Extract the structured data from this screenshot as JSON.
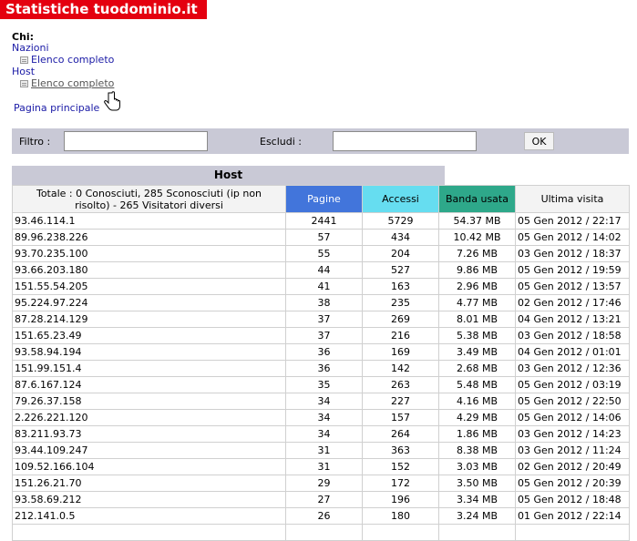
{
  "title": "Statistiche tuodominio.it",
  "nav": {
    "who_label": "Chi:",
    "nazioni": "Nazioni",
    "nazioni_full": "Elenco completo",
    "host": "Host",
    "host_full": "Elenco completo",
    "home": "Pagina principale"
  },
  "filter": {
    "filtro_label": "Filtro :",
    "escludi_label": "Escludi :",
    "filtro_value": "",
    "escludi_value": "",
    "ok_label": "OK"
  },
  "section_title": "Host",
  "columns": {
    "totale": "Totale : 0 Conosciuti, 285 Sconosciuti (ip non risolto) - 265 Visitatori diversi",
    "pagine": "Pagine",
    "accessi": "Accessi",
    "banda": "Banda usata",
    "ultima": "Ultima visita"
  },
  "colors": {
    "title_bg": "#e4000f",
    "pagine": "#4275db",
    "accessi": "#66ddf0",
    "banda": "#2ea88a",
    "bar": "#c9c9d6"
  },
  "rows": [
    {
      "host": "93.46.114.1",
      "pagine": "2441",
      "accessi": "5729",
      "banda": "54.37 MB",
      "ultima": "05 Gen 2012 / 22:17"
    },
    {
      "host": "89.96.238.226",
      "pagine": "57",
      "accessi": "434",
      "banda": "10.42 MB",
      "ultima": "05 Gen 2012 / 14:02"
    },
    {
      "host": "93.70.235.100",
      "pagine": "55",
      "accessi": "204",
      "banda": "7.26 MB",
      "ultima": "03 Gen 2012 / 18:37"
    },
    {
      "host": "93.66.203.180",
      "pagine": "44",
      "accessi": "527",
      "banda": "9.86 MB",
      "ultima": "05 Gen 2012 / 19:59"
    },
    {
      "host": "151.55.54.205",
      "pagine": "41",
      "accessi": "163",
      "banda": "2.96 MB",
      "ultima": "05 Gen 2012 / 13:57"
    },
    {
      "host": "95.224.97.224",
      "pagine": "38",
      "accessi": "235",
      "banda": "4.77 MB",
      "ultima": "02 Gen 2012 / 17:46"
    },
    {
      "host": "87.28.214.129",
      "pagine": "37",
      "accessi": "269",
      "banda": "8.01 MB",
      "ultima": "04 Gen 2012 / 13:21"
    },
    {
      "host": "151.65.23.49",
      "pagine": "37",
      "accessi": "216",
      "banda": "5.38 MB",
      "ultima": "03 Gen 2012 / 18:58"
    },
    {
      "host": "93.58.94.194",
      "pagine": "36",
      "accessi": "169",
      "banda": "3.49 MB",
      "ultima": "04 Gen 2012 / 01:01"
    },
    {
      "host": "151.99.151.4",
      "pagine": "36",
      "accessi": "142",
      "banda": "2.68 MB",
      "ultima": "03 Gen 2012 / 12:36"
    },
    {
      "host": "87.6.167.124",
      "pagine": "35",
      "accessi": "263",
      "banda": "5.48 MB",
      "ultima": "05 Gen 2012 / 03:19"
    },
    {
      "host": "79.26.37.158",
      "pagine": "34",
      "accessi": "227",
      "banda": "4.16 MB",
      "ultima": "05 Gen 2012 / 22:50"
    },
    {
      "host": "2.226.221.120",
      "pagine": "34",
      "accessi": "157",
      "banda": "4.29 MB",
      "ultima": "05 Gen 2012 / 14:06"
    },
    {
      "host": "83.211.93.73",
      "pagine": "34",
      "accessi": "264",
      "banda": "1.86 MB",
      "ultima": "03 Gen 2012 / 14:23"
    },
    {
      "host": "93.44.109.247",
      "pagine": "31",
      "accessi": "363",
      "banda": "8.38 MB",
      "ultima": "03 Gen 2012 / 11:24"
    },
    {
      "host": "109.52.166.104",
      "pagine": "31",
      "accessi": "152",
      "banda": "3.03 MB",
      "ultima": "02 Gen 2012 / 20:49"
    },
    {
      "host": "151.26.21.70",
      "pagine": "29",
      "accessi": "172",
      "banda": "3.50 MB",
      "ultima": "05 Gen 2012 / 20:39"
    },
    {
      "host": "93.58.69.212",
      "pagine": "27",
      "accessi": "196",
      "banda": "3.34 MB",
      "ultima": "05 Gen 2012 / 18:48"
    },
    {
      "host": "212.141.0.5",
      "pagine": "26",
      "accessi": "180",
      "banda": "3.24 MB",
      "ultima": "01 Gen 2012 / 22:14"
    },
    {
      "host": "",
      "pagine": "",
      "accessi": "",
      "banda": "",
      "ultima": ""
    }
  ]
}
